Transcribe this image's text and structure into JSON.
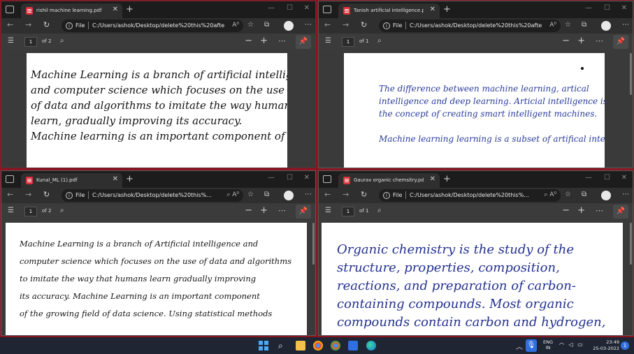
{
  "windows": {
    "top_left": {
      "tab_title": "rishil machine learning.pdf",
      "url": "C:/Users/ashok/Desktop/delete%20this%20afte...",
      "page_current": "1",
      "page_total": "of 2",
      "content_lines": [
        "Machine Learning is a branch of artificial intelligence",
        "and computer science which focuses on the use",
        "of data and algorithms to imitate the way humans",
        "learn, gradually improving its accuracy.",
        "Machine learning is an important component of"
      ]
    },
    "top_right": {
      "tab_title": "Tanish artificial intelligence.pdf",
      "url": "C:/Users/ashok/Desktop/delete%20this%20afte...",
      "page_current": "1",
      "page_total": "of 1",
      "content_lines": [
        "The difference between machine learning, artical",
        "intelligence and deep learning. Articial intelligence is",
        "the concept of creating smart intelligent machines.",
        "",
        "Machine learning learning is a subset of artifical intelligence"
      ]
    },
    "bottom_left": {
      "tab_title": "Kunal_ML (1).pdf",
      "url": "C:/Users/ashok/Desktop/delete%20this%...",
      "page_current": "1",
      "page_total": "of 2",
      "content_lines": [
        "Machine Learning is a branch of Artificial intelligence and",
        "computer science which focuses on the use of data and algorithms",
        "to imitate the way that humans learn gradually improving",
        "its accuracy. Machine Learning is an important component",
        "of the growing field of data science. Using statistical methods"
      ]
    },
    "bottom_right": {
      "tab_title": "Gaurav organic chemsitry.pdf",
      "url": "C:/Users/ashok/Desktop/delete%20this%...",
      "page_current": "1",
      "page_total": "of 1",
      "content_lines": [
        "Organic chemistry is the study of the",
        "structure, properties, composition,",
        "reactions, and preparation of carbon-",
        "containing compounds. Most organic",
        "compounds contain carbon and hydrogen,"
      ]
    }
  },
  "common": {
    "file_label": "File",
    "info_glyph": "i"
  },
  "taskbar": {
    "lang_line1": "ENG",
    "lang_line2": "IN",
    "time": "23:49",
    "date": "25-03-2022",
    "notification_count": "1"
  }
}
